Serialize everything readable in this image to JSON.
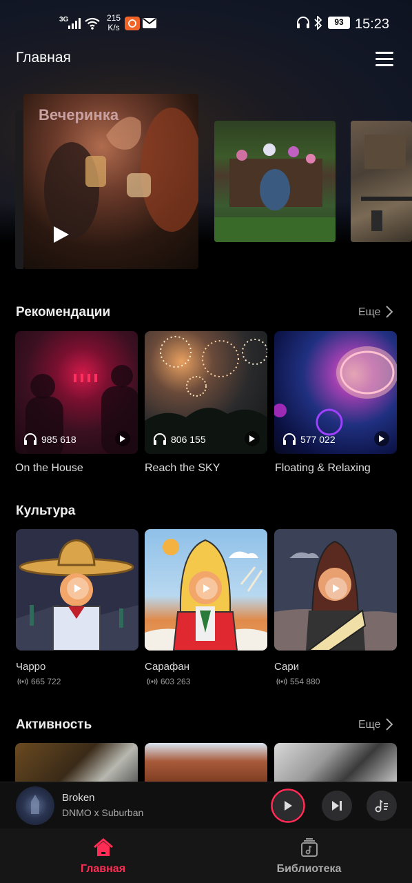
{
  "status_bar": {
    "network": "3G",
    "speed_value": "215",
    "speed_unit": "K/s",
    "battery": "93",
    "time": "15:23"
  },
  "header": {
    "title": "Главная",
    "menu_icon": "hamburger-menu-icon"
  },
  "featured": [
    {
      "title": "Вечеринка"
    },
    {
      "title": ""
    },
    {
      "title": ""
    }
  ],
  "recommendations": {
    "title": "Рекомендации",
    "more_label": "Еще",
    "items": [
      {
        "name": "On the House",
        "listens": "985 618"
      },
      {
        "name": "Reach the SKY",
        "listens": "806 155"
      },
      {
        "name": "Floating & Relaxing",
        "listens": "577 022"
      }
    ]
  },
  "culture": {
    "title": "Культура",
    "items": [
      {
        "name": "Чарро",
        "count": "665 722"
      },
      {
        "name": "Сарафан",
        "count": "603 263"
      },
      {
        "name": "Сари",
        "count": "554 880"
      }
    ]
  },
  "activity": {
    "title": "Активность",
    "more_label": "Еще"
  },
  "mini_player": {
    "track_title": "Broken",
    "artist": "DNMO x Suburban",
    "progress": 0.25
  },
  "bottom_nav": {
    "items": [
      {
        "label": "Главная",
        "icon": "home-icon",
        "active": true
      },
      {
        "label": "Библиотека",
        "icon": "library-icon",
        "active": false
      }
    ]
  },
  "colors": {
    "accent": "#ff2d55",
    "background": "#000000",
    "card_text": "#dddddd"
  }
}
